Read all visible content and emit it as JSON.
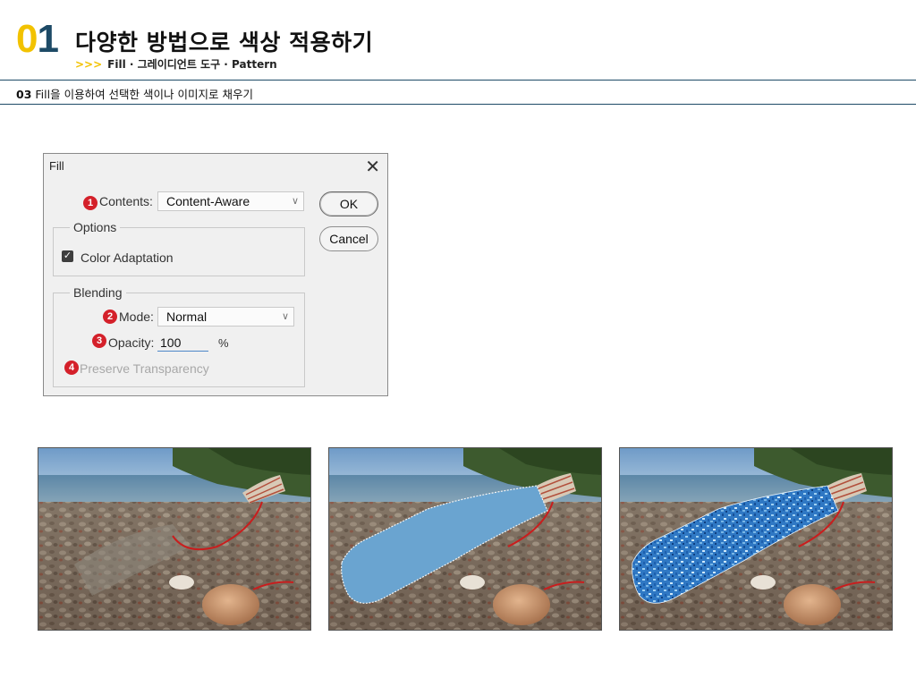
{
  "header": {
    "chapter_digit0": "0",
    "chapter_digit1": "1",
    "title": "다양한 방법으로 색상 적용하기",
    "subtitle_arrows": ">>>",
    "subtitle": "Fill · 그레이디언트 도구 · Pattern",
    "section_number": "03",
    "section_title": "Fill을 이용하여 선택한 색이나 이미지로 채우기"
  },
  "dialog": {
    "title": "Fill",
    "close_icon": "close-icon",
    "contents_label": "Contents:",
    "contents_value": "Content-Aware",
    "ok_label": "OK",
    "cancel_label": "Cancel",
    "options_title": "Options",
    "color_adaptation_label": "Color Adaptation",
    "color_adaptation_checked": true,
    "blending_title": "Blending",
    "mode_label": "Mode:",
    "mode_value": "Normal",
    "opacity_label": "Opacity:",
    "opacity_value": "100",
    "opacity_unit": "%",
    "preserve_label": "Preserve Transparency",
    "badges": [
      "1",
      "2",
      "3",
      "4"
    ]
  },
  "colors": {
    "accent_yellow": "#f2c200",
    "accent_navy": "#1d4a66",
    "badge_red": "#d4202a",
    "fill_blue": "#6aa4d0",
    "pattern_blue": "#2f78c4"
  }
}
